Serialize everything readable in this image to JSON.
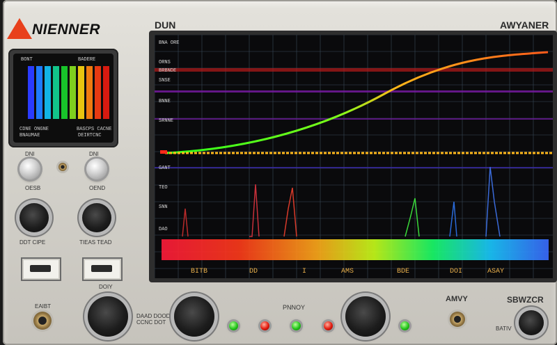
{
  "brand": "NIENNER",
  "header_left": "DUN",
  "header_right": "AWYANER",
  "mini_display": {
    "top_left": "BONT",
    "top_right": "BADERE",
    "bottom_left_1": "CDNE ONGNE",
    "bottom_left_2": "BNAUMAE",
    "bottom_right_1": "BASCPS CACNE",
    "bottom_right_2": "DEIRTCNC",
    "bar_colors": [
      "#2a3bff",
      "#1e7bff",
      "#12b4e6",
      "#12c48a",
      "#18c42a",
      "#7ed01e",
      "#e8c410",
      "#f07a10",
      "#e83a12",
      "#d81a10"
    ]
  },
  "controls": {
    "left_knob_label_1": "DNI",
    "left_knob_label_2": "DNI",
    "left_knob_caption_1": "OESB",
    "left_knob_caption_2": "OEND",
    "big_knob_caption_1": "DDT CIPE",
    "big_knob_caption_2": "TIEAS TEAD",
    "switch_caption_2": "DOIY",
    "bottom_left_label": "EAIBT",
    "center_caption": "DAAD DOODE\nCCNC DOT",
    "led_label": "PNNOY",
    "right_label_1": "AMVY",
    "right_label_2": "SBWZCR",
    "right_caption": "BATIV"
  },
  "screen": {
    "row_labels": [
      "BNA ORE",
      "ORNS",
      "BRBNDE",
      "SNSE",
      "BNNE",
      "SRNNE",
      "GANT",
      "TEO",
      "SNN",
      "DAO"
    ],
    "bottom_labels": [
      "BITB",
      "DD",
      "I",
      "AMS",
      "BDE",
      "DOI",
      "ASAY"
    ],
    "grid_color": "#3a4a5a",
    "trace_colors": [
      "#2aff1a",
      "#ffb81a",
      "#ff5a1a"
    ]
  }
}
